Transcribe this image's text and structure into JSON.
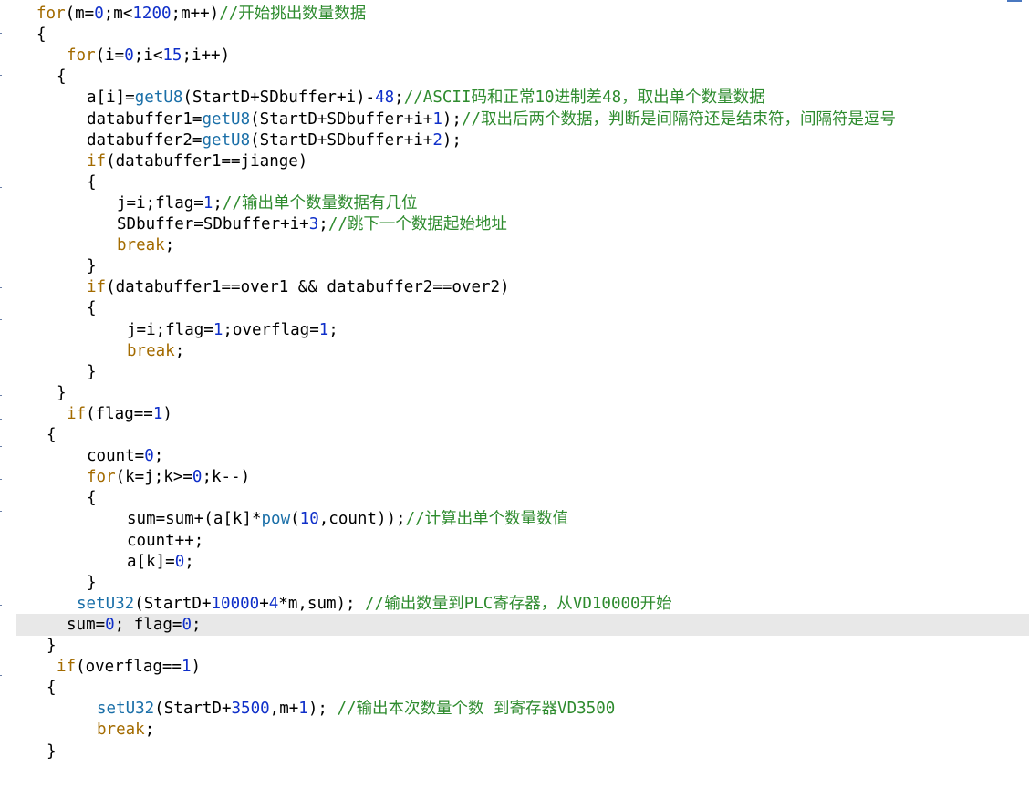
{
  "colors": {
    "keyword": "#a36b00",
    "number": "#0f2fc9",
    "function": "#1a6fa8",
    "comment": "#2e8b2e",
    "text": "#000000",
    "current_line_bg": "#e8e8e8"
  },
  "editor": {
    "current_line": 29,
    "lines": [
      {
        "tokens": [
          {
            "t": "for",
            "c": "kw"
          },
          {
            "t": "(m=",
            "c": "plain"
          },
          {
            "t": "0",
            "c": "num"
          },
          {
            "t": ";m<",
            "c": "plain"
          },
          {
            "t": "1200",
            "c": "num"
          },
          {
            "t": ";m++)",
            "c": "plain"
          },
          {
            "t": "//开始挑出数量数据",
            "c": "cm"
          }
        ]
      },
      {
        "tokens": [
          {
            "t": "{",
            "c": "plain"
          }
        ]
      },
      {
        "tokens": [
          {
            "t": "for",
            "c": "kw"
          },
          {
            "t": "(i=",
            "c": "plain"
          },
          {
            "t": "0",
            "c": "num"
          },
          {
            "t": ";i<",
            "c": "plain"
          },
          {
            "t": "15",
            "c": "num"
          },
          {
            "t": ";i++)",
            "c": "plain"
          }
        ]
      },
      {
        "tokens": [
          {
            "t": "{",
            "c": "plain"
          }
        ]
      },
      {
        "tokens": [
          {
            "t": "a[i]=",
            "c": "plain"
          },
          {
            "t": "getU8",
            "c": "fn"
          },
          {
            "t": "(StartD+SDbuffer+i)-",
            "c": "plain"
          },
          {
            "t": "48",
            "c": "num"
          },
          {
            "t": ";",
            "c": "plain"
          },
          {
            "t": "//ASCII码和正常",
            "c": "cm"
          },
          {
            "t": "10",
            "c": "cm"
          },
          {
            "t": "进制差",
            "c": "cm"
          },
          {
            "t": "48",
            "c": "cm"
          },
          {
            "t": "，取出单个数量数据",
            "c": "cm"
          }
        ]
      },
      {
        "tokens": [
          {
            "t": "databuffer1=",
            "c": "plain"
          },
          {
            "t": "getU8",
            "c": "fn"
          },
          {
            "t": "(StartD+SDbuffer+i+",
            "c": "plain"
          },
          {
            "t": "1",
            "c": "num"
          },
          {
            "t": ");",
            "c": "plain"
          },
          {
            "t": "//取出后两个数据，判断是间隔符还是结束符，间隔符是逗号",
            "c": "cm"
          }
        ]
      },
      {
        "tokens": [
          {
            "t": "databuffer2=",
            "c": "plain"
          },
          {
            "t": "getU8",
            "c": "fn"
          },
          {
            "t": "(StartD+SDbuffer+i+",
            "c": "plain"
          },
          {
            "t": "2",
            "c": "num"
          },
          {
            "t": ");",
            "c": "plain"
          }
        ]
      },
      {
        "tokens": [
          {
            "t": "if",
            "c": "kw"
          },
          {
            "t": "(databuffer1==jiange)",
            "c": "plain"
          }
        ]
      },
      {
        "tokens": [
          {
            "t": "{",
            "c": "plain"
          }
        ]
      },
      {
        "tokens": [
          {
            "t": "j=i;flag=",
            "c": "plain"
          },
          {
            "t": "1",
            "c": "num"
          },
          {
            "t": ";",
            "c": "plain"
          },
          {
            "t": "//输出单个数量数据有几位",
            "c": "cm"
          }
        ]
      },
      {
        "tokens": [
          {
            "t": "SDbuffer=SDbuffer+i+",
            "c": "plain"
          },
          {
            "t": "3",
            "c": "num"
          },
          {
            "t": ";",
            "c": "plain"
          },
          {
            "t": "//跳下一个数据起始地址",
            "c": "cm"
          }
        ]
      },
      {
        "tokens": [
          {
            "t": "break",
            "c": "kw"
          },
          {
            "t": ";",
            "c": "plain"
          }
        ]
      },
      {
        "tokens": [
          {
            "t": "}",
            "c": "plain"
          }
        ]
      },
      {
        "tokens": [
          {
            "t": "if",
            "c": "kw"
          },
          {
            "t": "(databuffer1==over1 && databuffer2==over2)",
            "c": "plain"
          }
        ]
      },
      {
        "tokens": [
          {
            "t": "{",
            "c": "plain"
          }
        ]
      },
      {
        "tokens": [
          {
            "t": "j=i;flag=",
            "c": "plain"
          },
          {
            "t": "1",
            "c": "num"
          },
          {
            "t": ";overflag=",
            "c": "plain"
          },
          {
            "t": "1",
            "c": "num"
          },
          {
            "t": ";",
            "c": "plain"
          }
        ]
      },
      {
        "tokens": [
          {
            "t": "break",
            "c": "kw"
          },
          {
            "t": ";",
            "c": "plain"
          }
        ]
      },
      {
        "tokens": [
          {
            "t": "}",
            "c": "plain"
          }
        ]
      },
      {
        "tokens": [
          {
            "t": "}",
            "c": "plain"
          }
        ]
      },
      {
        "tokens": [
          {
            "t": "if",
            "c": "kw"
          },
          {
            "t": "(flag==",
            "c": "plain"
          },
          {
            "t": "1",
            "c": "num"
          },
          {
            "t": ")",
            "c": "plain"
          }
        ]
      },
      {
        "tokens": [
          {
            "t": "{",
            "c": "plain"
          }
        ]
      },
      {
        "tokens": [
          {
            "t": "count=",
            "c": "plain"
          },
          {
            "t": "0",
            "c": "num"
          },
          {
            "t": ";",
            "c": "plain"
          }
        ]
      },
      {
        "tokens": [
          {
            "t": "for",
            "c": "kw"
          },
          {
            "t": "(k=j;k>=",
            "c": "plain"
          },
          {
            "t": "0",
            "c": "num"
          },
          {
            "t": ";k--)",
            "c": "plain"
          }
        ]
      },
      {
        "tokens": [
          {
            "t": "{",
            "c": "plain"
          }
        ]
      },
      {
        "tokens": [
          {
            "t": "sum=sum+(a[k]*",
            "c": "plain"
          },
          {
            "t": "pow",
            "c": "fn"
          },
          {
            "t": "(",
            "c": "plain"
          },
          {
            "t": "10",
            "c": "num"
          },
          {
            "t": ",count));",
            "c": "plain"
          },
          {
            "t": "//计算出单个数量数值",
            "c": "cm"
          }
        ]
      },
      {
        "tokens": [
          {
            "t": "count++;",
            "c": "plain"
          }
        ]
      },
      {
        "tokens": [
          {
            "t": "a[k]=",
            "c": "plain"
          },
          {
            "t": "0",
            "c": "num"
          },
          {
            "t": ";",
            "c": "plain"
          }
        ]
      },
      {
        "tokens": [
          {
            "t": "}",
            "c": "plain"
          }
        ]
      },
      {
        "tokens": [
          {
            "t": "setU32",
            "c": "fn"
          },
          {
            "t": "(StartD+",
            "c": "plain"
          },
          {
            "t": "10000",
            "c": "num"
          },
          {
            "t": "+",
            "c": "plain"
          },
          {
            "t": "4",
            "c": "num"
          },
          {
            "t": "*m,sum); ",
            "c": "plain"
          },
          {
            "t": "//输出数量到",
            "c": "cm"
          },
          {
            "t": "PLC",
            "c": "cm"
          },
          {
            "t": "寄存器，从",
            "c": "cm"
          },
          {
            "t": "VD10000",
            "c": "cm"
          },
          {
            "t": "开始",
            "c": "cm"
          }
        ]
      },
      {
        "tokens": [
          {
            "t": "sum=",
            "c": "plain"
          },
          {
            "t": "0",
            "c": "num"
          },
          {
            "t": "; flag=",
            "c": "plain"
          },
          {
            "t": "0",
            "c": "num"
          },
          {
            "t": ";",
            "c": "plain"
          }
        ]
      },
      {
        "tokens": [
          {
            "t": "}",
            "c": "plain"
          }
        ]
      },
      {
        "tokens": [
          {
            "t": "if",
            "c": "kw"
          },
          {
            "t": "(overflag==",
            "c": "plain"
          },
          {
            "t": "1",
            "c": "num"
          },
          {
            "t": ")",
            "c": "plain"
          }
        ]
      },
      {
        "tokens": [
          {
            "t": "{",
            "c": "plain"
          }
        ]
      },
      {
        "tokens": [
          {
            "t": "setU32",
            "c": "fn"
          },
          {
            "t": "(StartD+",
            "c": "plain"
          },
          {
            "t": "3500",
            "c": "num"
          },
          {
            "t": ",m+",
            "c": "plain"
          },
          {
            "t": "1",
            "c": "num"
          },
          {
            "t": "); ",
            "c": "plain"
          },
          {
            "t": "//输出本次数量个数 到寄存器",
            "c": "cm"
          },
          {
            "t": "VD3500",
            "c": "cm"
          }
        ]
      },
      {
        "tokens": [
          {
            "t": "break",
            "c": "kw"
          },
          {
            "t": ";",
            "c": "plain"
          }
        ]
      },
      {
        "tokens": [
          {
            "t": "}",
            "c": "plain"
          }
        ]
      }
    ]
  }
}
